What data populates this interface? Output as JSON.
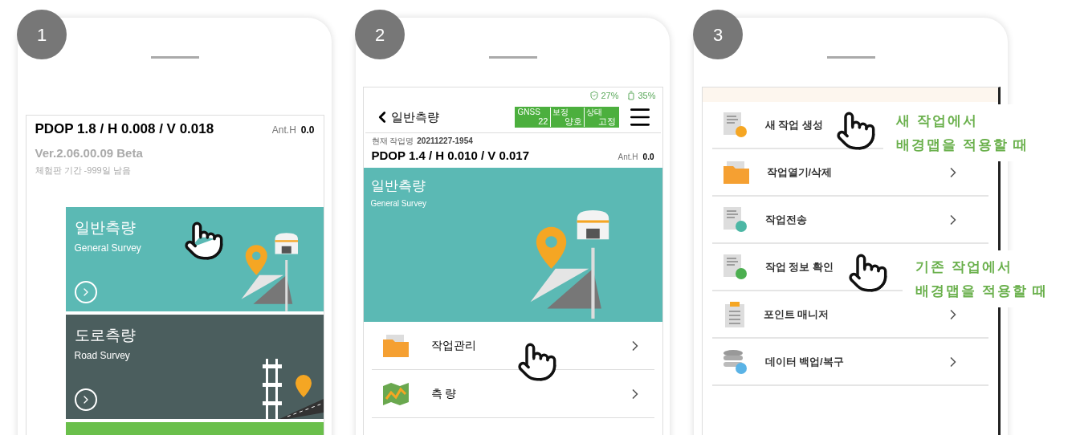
{
  "panels": [
    {
      "number": "1",
      "kind": "home",
      "pdop": "PDOP 1.8 / H 0.008 / V 0.018",
      "ant_label": "Ant.H",
      "ant_value": "0.0",
      "version": "Ver.2.06.00.09  Beta",
      "trial": "체험판 기간 -999일 남음",
      "tiles": [
        {
          "title": "일반측량",
          "subtitle": "General Survey",
          "color": "#5bb9b4",
          "kind": "general"
        },
        {
          "title": "도로측량",
          "subtitle": "Road Survey",
          "color": "#4b5e5e",
          "kind": "road"
        },
        {
          "color": "#6abf4b",
          "kind": "plain"
        }
      ]
    },
    {
      "number": "2",
      "kind": "survey",
      "status": [
        {
          "kind": "signal",
          "text": "27%"
        },
        {
          "kind": "battery",
          "text": "35%"
        }
      ],
      "back_title": "일반측량",
      "gnss": [
        {
          "label": "GNSS",
          "value": "22"
        },
        {
          "label": "보정",
          "value": "양호"
        },
        {
          "label": "상태",
          "value": "고정"
        }
      ],
      "job_label": "현재 작업명",
      "job_name": "20211227-1954",
      "pdop": "PDOP 1.4 / H 0.010 / V 0.017",
      "ant_label": "Ant.H",
      "ant_value": "0.0",
      "banner": {
        "title": "일반측량",
        "subtitle": "General Survey"
      },
      "menu": [
        {
          "label": "작업관리",
          "kind": "folder"
        },
        {
          "label": "측 량",
          "kind": "map"
        }
      ]
    },
    {
      "number": "3",
      "kind": "jobs",
      "menu": [
        {
          "label": "새 작업 생성",
          "kind": "new"
        },
        {
          "label": "작업열기/삭제",
          "kind": "folder",
          "chevron": true
        },
        {
          "label": "작업전송",
          "kind": "transfer",
          "chevron": true
        },
        {
          "label": "작업 정보 확인",
          "kind": "info"
        },
        {
          "label": "포인트 매니저",
          "kind": "list",
          "chevron": true
        },
        {
          "label": "데이터 백업/복구",
          "kind": "database",
          "chevron": true
        }
      ],
      "callouts": [
        {
          "lines": [
            "새 작업에서",
            "배경맵을 적용할 때"
          ]
        },
        {
          "lines": [
            "기존 작업에서",
            "배경맵을 적용할 때"
          ]
        }
      ]
    }
  ]
}
